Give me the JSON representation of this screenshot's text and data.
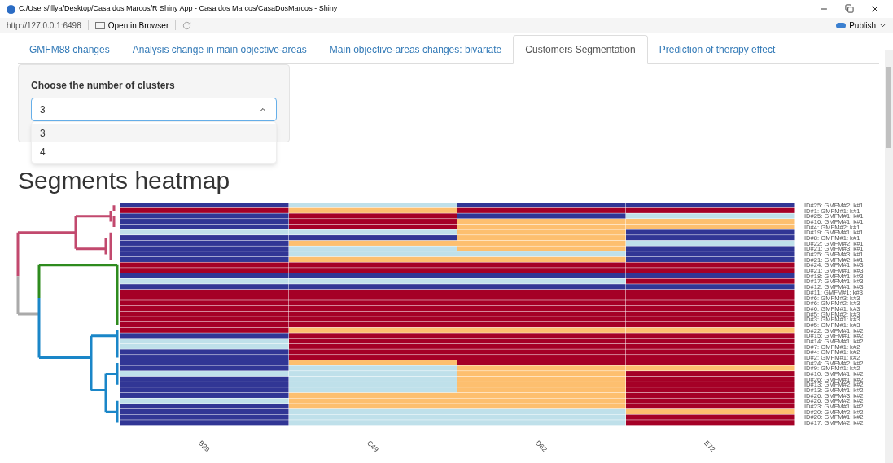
{
  "window": {
    "title": "C:/Users/Illya/Desktop/Casa dos Marcos/R Shiny App - Casa dos Marcos/CasaDosMarcos - Shiny"
  },
  "toolbar": {
    "url": "http://127.0.0.1:6498",
    "open_button": "Open in Browser",
    "publish_button": "Publish"
  },
  "tabs": [
    {
      "label": "GMFM88 changes",
      "selected": false
    },
    {
      "label": "Analysis change in main objective-areas",
      "selected": false
    },
    {
      "label": "Main objective-areas changes: bivariate",
      "selected": false
    },
    {
      "label": "Customers Segmentation",
      "selected": true
    },
    {
      "label": "Prediction of therapy effect",
      "selected": false
    }
  ],
  "clusters": {
    "label": "Choose the number of clusters",
    "value": "3",
    "expanded": true,
    "options": [
      {
        "label": "3",
        "selected": true
      },
      {
        "label": "4",
        "selected": false
      }
    ]
  },
  "heatmap": {
    "title": "Segments heatmap",
    "columns": [
      "B29",
      "C49",
      "D62",
      "E72"
    ],
    "rows": [
      {
        "label": "ID#25: GMFM#2: k#1",
        "cells": [
          {
            "color": "#313695"
          },
          {
            "color": "#bfe0ea"
          },
          {
            "color": "#313695"
          },
          {
            "color": "#313695"
          }
        ]
      },
      {
        "label": "ID#1: GMFM#1: k#1",
        "cells": [
          {
            "color": "#a50026"
          },
          {
            "color": "#fdbf6f"
          },
          {
            "color": "#a50026"
          },
          {
            "color": "#a50026"
          }
        ]
      },
      {
        "label": "ID#25: GMFM#1: k#1",
        "cells": [
          {
            "color": "#313695"
          },
          {
            "color": "#a50026"
          },
          {
            "color": "#313695"
          },
          {
            "color": "#bfe0ea"
          }
        ]
      },
      {
        "label": "ID#16: GMFM#1: k#1",
        "cells": [
          {
            "color": "#313695"
          },
          {
            "color": "#a50026"
          },
          {
            "color": "#fdbf6f"
          },
          {
            "color": "#fdbf6f"
          }
        ]
      },
      {
        "label": "ID#4: GMFM#2: k#1",
        "cells": [
          {
            "color": "#313695"
          },
          {
            "color": "#a50026"
          },
          {
            "color": "#fdbf6f"
          },
          {
            "color": "#fdbf6f"
          }
        ]
      },
      {
        "label": "ID#19: GMFM#1: k#1",
        "cells": [
          {
            "color": "#bfe0ea"
          },
          {
            "color": "#bfe0ea"
          },
          {
            "color": "#fdbf6f"
          },
          {
            "color": "#313695"
          }
        ]
      },
      {
        "label": "ID#8: GMFM#1: k#1",
        "cells": [
          {
            "color": "#313695"
          },
          {
            "color": "#313695"
          },
          {
            "color": "#fdbf6f"
          },
          {
            "color": "#313695"
          }
        ]
      },
      {
        "label": "ID#22: GMFM#2: k#1",
        "cells": [
          {
            "color": "#313695"
          },
          {
            "color": "#fdbf6f"
          },
          {
            "color": "#fdbf6f"
          },
          {
            "color": "#bfe0ea"
          }
        ]
      },
      {
        "label": "ID#21: GMFM#3: k#1",
        "cells": [
          {
            "color": "#313695"
          },
          {
            "color": "#bfe0ea"
          },
          {
            "color": "#fdbf6f"
          },
          {
            "color": "#313695"
          }
        ]
      },
      {
        "label": "ID#25: GMFM#3: k#1",
        "cells": [
          {
            "color": "#313695"
          },
          {
            "color": "#bfe0ea"
          },
          {
            "color": "#bfe0ea"
          },
          {
            "color": "#313695"
          }
        ]
      },
      {
        "label": "ID#21: GMFM#2: k#1",
        "cells": [
          {
            "color": "#313695"
          },
          {
            "color": "#fdbf6f"
          },
          {
            "color": "#fdbf6f"
          },
          {
            "color": "#313695"
          }
        ]
      },
      {
        "label": "ID#24: GMFM#1: k#3",
        "cells": [
          {
            "color": "#a50026"
          },
          {
            "color": "#a50026"
          },
          {
            "color": "#a50026"
          },
          {
            "color": "#a50026"
          }
        ]
      },
      {
        "label": "ID#21: GMFM#1: k#3",
        "cells": [
          {
            "color": "#a50026"
          },
          {
            "color": "#a50026"
          },
          {
            "color": "#a50026"
          },
          {
            "color": "#a50026"
          }
        ]
      },
      {
        "label": "ID#18: GMFM#1: k#3",
        "cells": [
          {
            "color": "#313695"
          },
          {
            "color": "#313695"
          },
          {
            "color": "#313695"
          },
          {
            "color": "#313695"
          }
        ]
      },
      {
        "label": "ID#17: GMFM#1: k#3",
        "cells": [
          {
            "color": "#bfe0ea"
          },
          {
            "color": "#bfe0ea"
          },
          {
            "color": "#bfe0ea"
          },
          {
            "color": "#a50026"
          }
        ]
      },
      {
        "label": "ID#12: GMFM#1: k#3",
        "cells": [
          {
            "color": "#313695"
          },
          {
            "color": "#313695"
          },
          {
            "color": "#313695"
          },
          {
            "color": "#313695"
          }
        ]
      },
      {
        "label": "ID#11: GMFM#1: k#3",
        "cells": [
          {
            "color": "#a50026"
          },
          {
            "color": "#a50026"
          },
          {
            "color": "#a50026"
          },
          {
            "color": "#a50026"
          }
        ]
      },
      {
        "label": "ID#6: GMFM#3: k#3",
        "cells": [
          {
            "color": "#a50026"
          },
          {
            "color": "#a50026"
          },
          {
            "color": "#a50026"
          },
          {
            "color": "#a50026"
          }
        ]
      },
      {
        "label": "ID#6: GMFM#2: k#3",
        "cells": [
          {
            "color": "#a50026"
          },
          {
            "color": "#a50026"
          },
          {
            "color": "#a50026"
          },
          {
            "color": "#a50026"
          }
        ]
      },
      {
        "label": "ID#6: GMFM#1: k#3",
        "cells": [
          {
            "color": "#a50026"
          },
          {
            "color": "#a50026"
          },
          {
            "color": "#a50026"
          },
          {
            "color": "#a50026"
          }
        ]
      },
      {
        "label": "ID#5: GMFM#2: k#3",
        "cells": [
          {
            "color": "#a50026"
          },
          {
            "color": "#a50026"
          },
          {
            "color": "#a50026"
          },
          {
            "color": "#a50026"
          }
        ]
      },
      {
        "label": "ID#3: GMFM#1: k#3",
        "cells": [
          {
            "color": "#a50026"
          },
          {
            "color": "#a50026"
          },
          {
            "color": "#a50026"
          },
          {
            "color": "#a50026"
          }
        ]
      },
      {
        "label": "ID#5: GMFM#1: k#3",
        "cells": [
          {
            "color": "#a50026"
          },
          {
            "color": "#a50026"
          },
          {
            "color": "#a50026"
          },
          {
            "color": "#a50026"
          }
        ]
      },
      {
        "label": "ID#22: GMFM#1: k#2",
        "cells": [
          {
            "color": "#a50026"
          },
          {
            "color": "#fdbf6f"
          },
          {
            "color": "#fdbf6f"
          },
          {
            "color": "#fdbf6f"
          }
        ]
      },
      {
        "label": "ID#15: GMFM#1: k#2",
        "cells": [
          {
            "color": "#313695"
          },
          {
            "color": "#a50026"
          },
          {
            "color": "#a50026"
          },
          {
            "color": "#a50026"
          }
        ]
      },
      {
        "label": "ID#14: GMFM#1: k#2",
        "cells": [
          {
            "color": "#bfe0ea"
          },
          {
            "color": "#a50026"
          },
          {
            "color": "#a50026"
          },
          {
            "color": "#a50026"
          }
        ]
      },
      {
        "label": "ID#7: GMFM#1: k#2",
        "cells": [
          {
            "color": "#bfe0ea"
          },
          {
            "color": "#a50026"
          },
          {
            "color": "#a50026"
          },
          {
            "color": "#a50026"
          }
        ]
      },
      {
        "label": "ID#4: GMFM#1: k#2",
        "cells": [
          {
            "color": "#313695"
          },
          {
            "color": "#a50026"
          },
          {
            "color": "#a50026"
          },
          {
            "color": "#a50026"
          }
        ]
      },
      {
        "label": "ID#2: GMFM#1: k#2",
        "cells": [
          {
            "color": "#313695"
          },
          {
            "color": "#a50026"
          },
          {
            "color": "#a50026"
          },
          {
            "color": "#a50026"
          }
        ]
      },
      {
        "label": "ID#24: GMFM#2: k#2",
        "cells": [
          {
            "color": "#313695"
          },
          {
            "color": "#fdbf6f"
          },
          {
            "color": "#a50026"
          },
          {
            "color": "#a50026"
          }
        ]
      },
      {
        "label": "ID#9: GMFM#1: k#2",
        "cells": [
          {
            "color": "#313695"
          },
          {
            "color": "#bfe0ea"
          },
          {
            "color": "#fdbf6f"
          },
          {
            "color": "#fdbf6f"
          }
        ]
      },
      {
        "label": "ID#10: GMFM#1: k#2",
        "cells": [
          {
            "color": "#bfe0ea"
          },
          {
            "color": "#bfe0ea"
          },
          {
            "color": "#fdbf6f"
          },
          {
            "color": "#a50026"
          }
        ]
      },
      {
        "label": "ID#26: GMFM#1: k#2",
        "cells": [
          {
            "color": "#313695"
          },
          {
            "color": "#bfe0ea"
          },
          {
            "color": "#fdbf6f"
          },
          {
            "color": "#a50026"
          }
        ]
      },
      {
        "label": "ID#13: GMFM#2: k#2",
        "cells": [
          {
            "color": "#313695"
          },
          {
            "color": "#bfe0ea"
          },
          {
            "color": "#fdbf6f"
          },
          {
            "color": "#a50026"
          }
        ]
      },
      {
        "label": "ID#13: GMFM#1: k#2",
        "cells": [
          {
            "color": "#313695"
          },
          {
            "color": "#bfe0ea"
          },
          {
            "color": "#fdbf6f"
          },
          {
            "color": "#a50026"
          }
        ]
      },
      {
        "label": "ID#26: GMFM#3: k#2",
        "cells": [
          {
            "color": "#313695"
          },
          {
            "color": "#fdbf6f"
          },
          {
            "color": "#fdbf6f"
          },
          {
            "color": "#a50026"
          }
        ]
      },
      {
        "label": "ID#26: GMFM#2: k#2",
        "cells": [
          {
            "color": "#bfe0ea"
          },
          {
            "color": "#fdbf6f"
          },
          {
            "color": "#fdbf6f"
          },
          {
            "color": "#a50026"
          }
        ]
      },
      {
        "label": "ID#23: GMFM#1: k#2",
        "cells": [
          {
            "color": "#313695"
          },
          {
            "color": "#fdbf6f"
          },
          {
            "color": "#fdbf6f"
          },
          {
            "color": "#a50026"
          }
        ]
      },
      {
        "label": "ID#20: GMFM#2: k#2",
        "cells": [
          {
            "color": "#313695"
          },
          {
            "color": "#bfe0ea"
          },
          {
            "color": "#bfe0ea"
          },
          {
            "color": "#fdbf6f"
          }
        ]
      },
      {
        "label": "ID#20: GMFM#1: k#2",
        "cells": [
          {
            "color": "#313695"
          },
          {
            "color": "#bfe0ea"
          },
          {
            "color": "#bfe0ea"
          },
          {
            "color": "#a50026"
          }
        ]
      },
      {
        "label": "ID#17: GMFM#2: k#2",
        "cells": [
          {
            "color": "#313695"
          },
          {
            "color": "#bfe0ea"
          },
          {
            "color": "#bfe0ea"
          },
          {
            "color": "#a50026"
          }
        ]
      }
    ]
  }
}
